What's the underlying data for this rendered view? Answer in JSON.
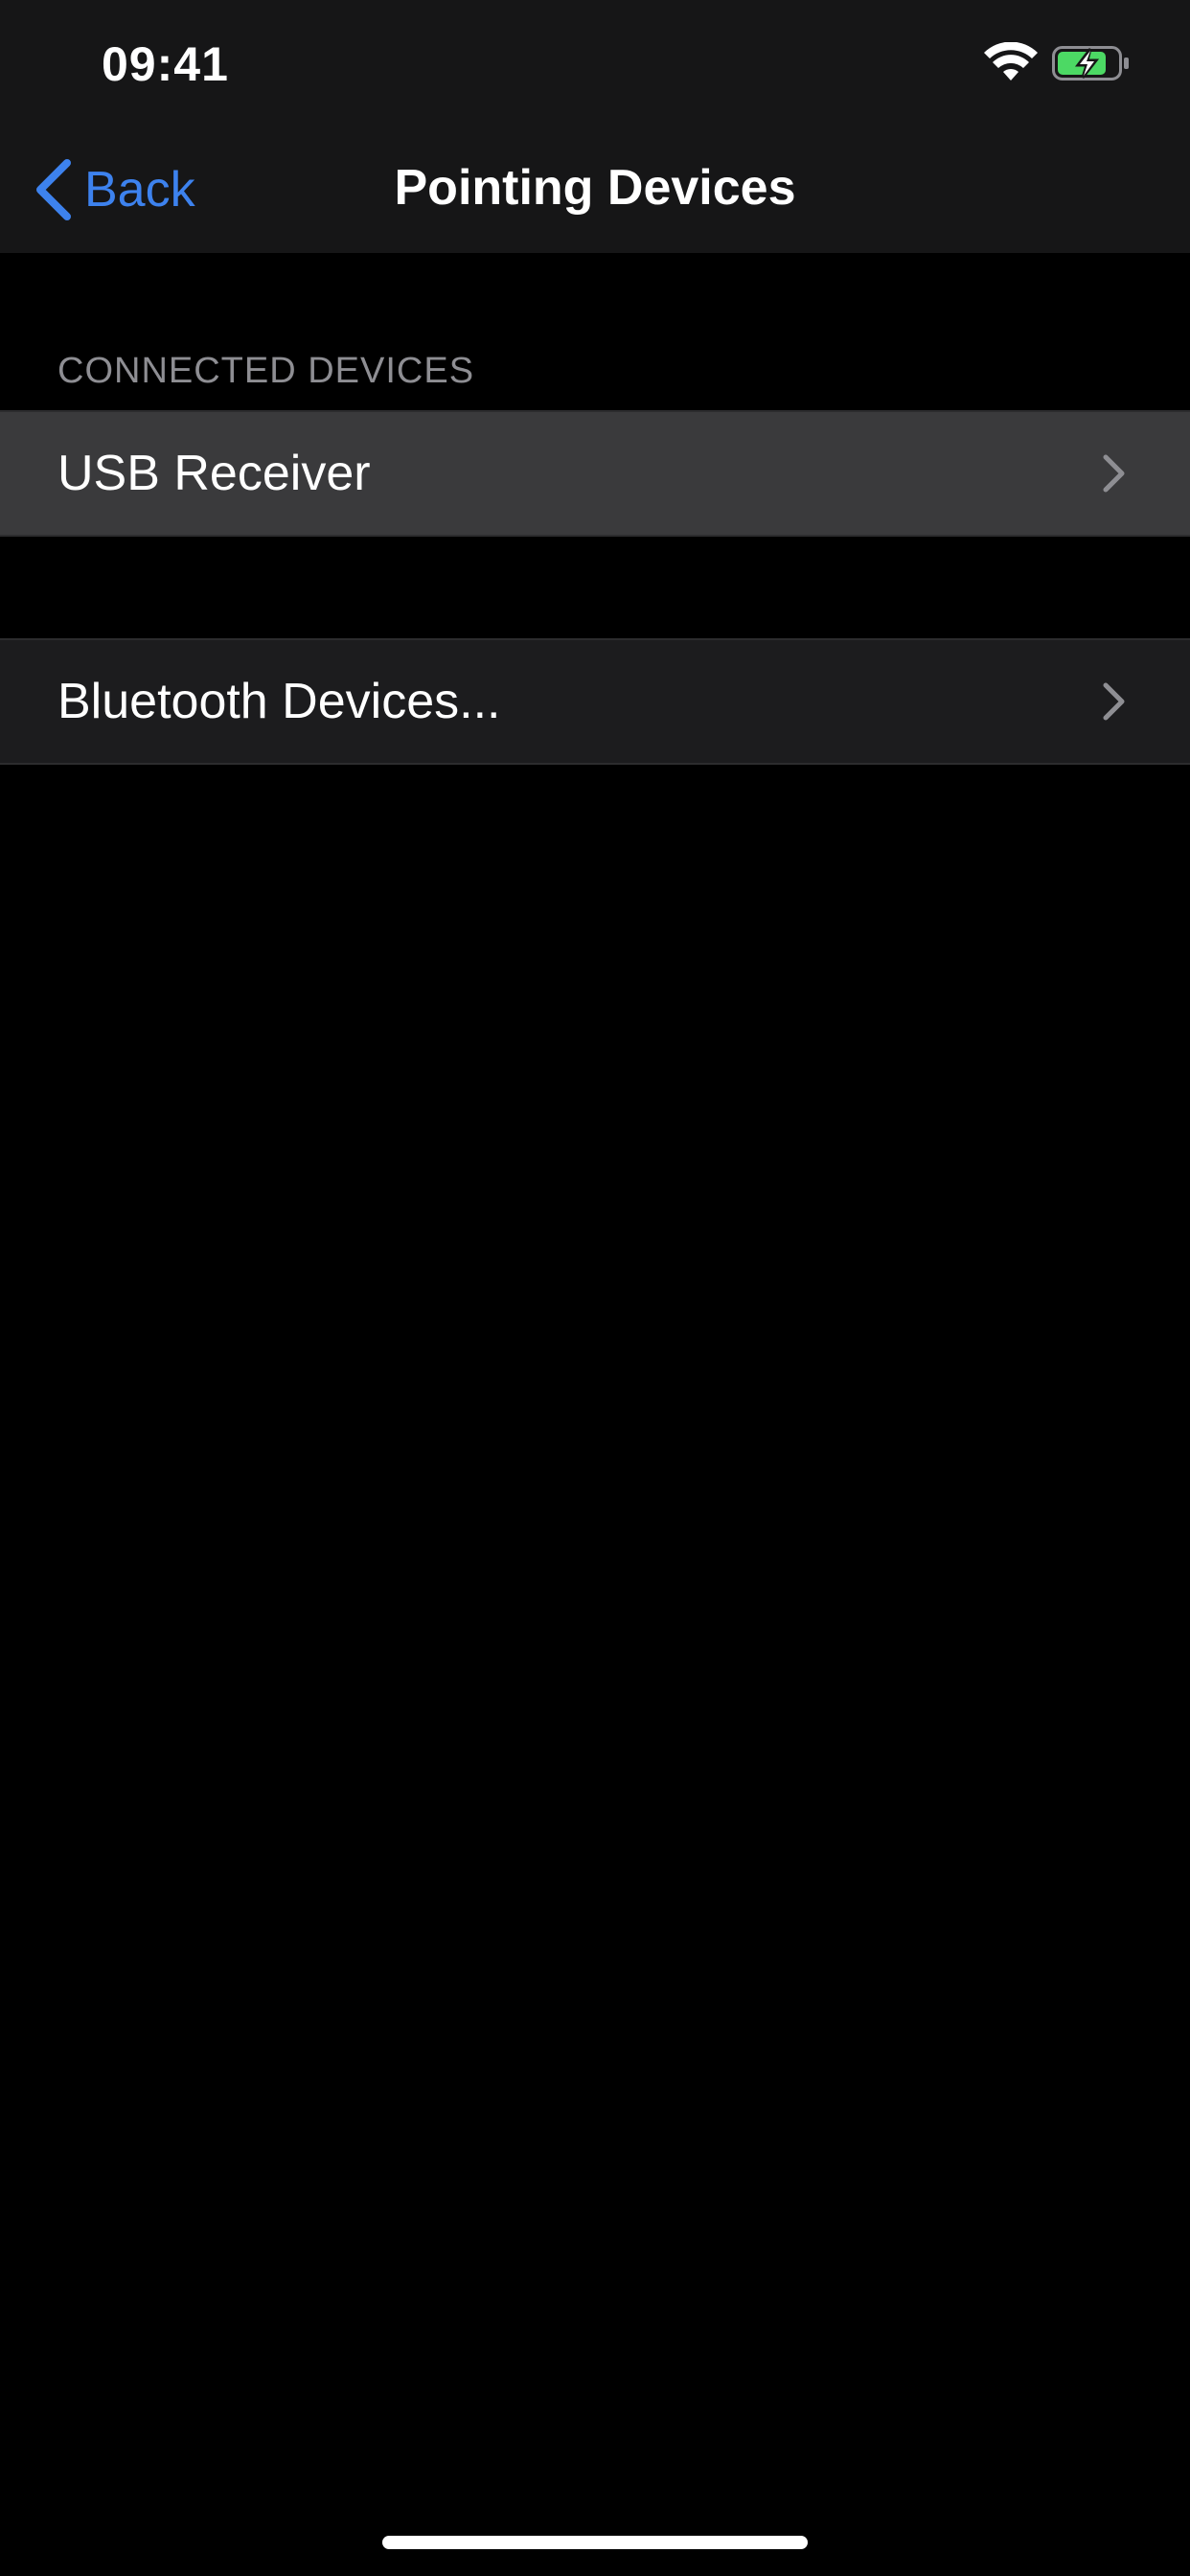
{
  "status_bar": {
    "time": "09:41",
    "wifi_icon": "wifi-icon",
    "battery_icon": "battery-charging-icon",
    "battery_color": "#4cd964"
  },
  "nav": {
    "back_label": "Back",
    "title": "Pointing Devices",
    "accent_color": "#3d82ee"
  },
  "sections": {
    "connected_header": "CONNECTED DEVICES",
    "rows": [
      {
        "label": "USB Receiver",
        "icon": "chevron-right-icon"
      },
      {
        "label": "Bluetooth Devices...",
        "icon": "chevron-right-icon"
      }
    ]
  }
}
